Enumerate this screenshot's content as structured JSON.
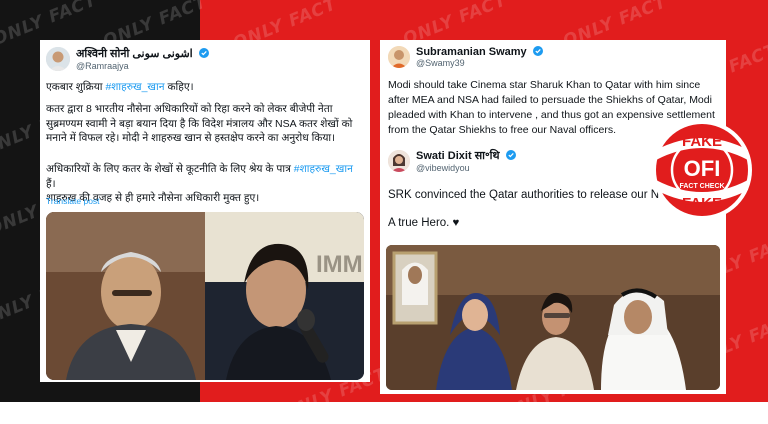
{
  "watermark": {
    "text": "ONLY FACT"
  },
  "left_tweet": {
    "author_name": "अश्विनी सोनी اشونی سونی",
    "author_handle": "@Ramraajya",
    "line1_pre": "एकबार शुक्रिया ",
    "line1_hashtag": "#शाहरुख_खान",
    "line1_post": " कहिए।",
    "para2": "कतर द्वारा 8 भारतीय नौसेना अधिकारियों को रिहा करने को लेकर बीजेपी नेता सुब्रमण्यम स्वामी ने बड़ा बयान दिया है कि विदेश मंत्रालय और NSA कतर शेखों को मनाने में विफल रहे। मोदी ने शाहरुख खान से हस्तक्षेप करने का अनुरोध किया।",
    "para3_pre": "अधिकारियों के लिए कतर के शेखों से कूटनीति के लिए श्रेय के पात्र ",
    "para3_hashtag": "#शाहरुख_खान",
    "para3_post": " हैं।",
    "para3_line2": "शाहरुख की वजह से ही हमारे नौसेना अधिकारी मुक्त हुए।",
    "translate_label": "Translate post",
    "photo_text": "IMM"
  },
  "right_tweet": {
    "author_name": "Subramanian Swamy",
    "author_handle": "@Swamy39",
    "text": "Modi should take Cinema star Sharuk Khan to Qatar with him since after MEA and NSA had failed to persuade the Shiekhs of Qatar, Modi pleaded with Khan to intervene , and thus got an expensive settlement from the Qatar Shiekhs to free our Naval officers."
  },
  "quoted_tweet": {
    "author_name": "Swati Dixit",
    "author_name_suffix": "सा॰थि",
    "author_handle": "@vibewidyou",
    "line1": "SRK convinced the Qatar authorities to release our N",
    "line2": "A true Hero. ♥"
  },
  "stamp": {
    "top": "FAKE",
    "brand": "OFI",
    "subtitle": "FACT CHECK",
    "bottom": "FAKE",
    "color": "#e11d1d"
  },
  "colors": {
    "accent": "#e11d1d",
    "link": "#1d9bf0",
    "verified": "#1d9bf0",
    "left_bg": "#141414"
  },
  "icons": [
    "verified-badge-icon",
    "heart-icon"
  ]
}
